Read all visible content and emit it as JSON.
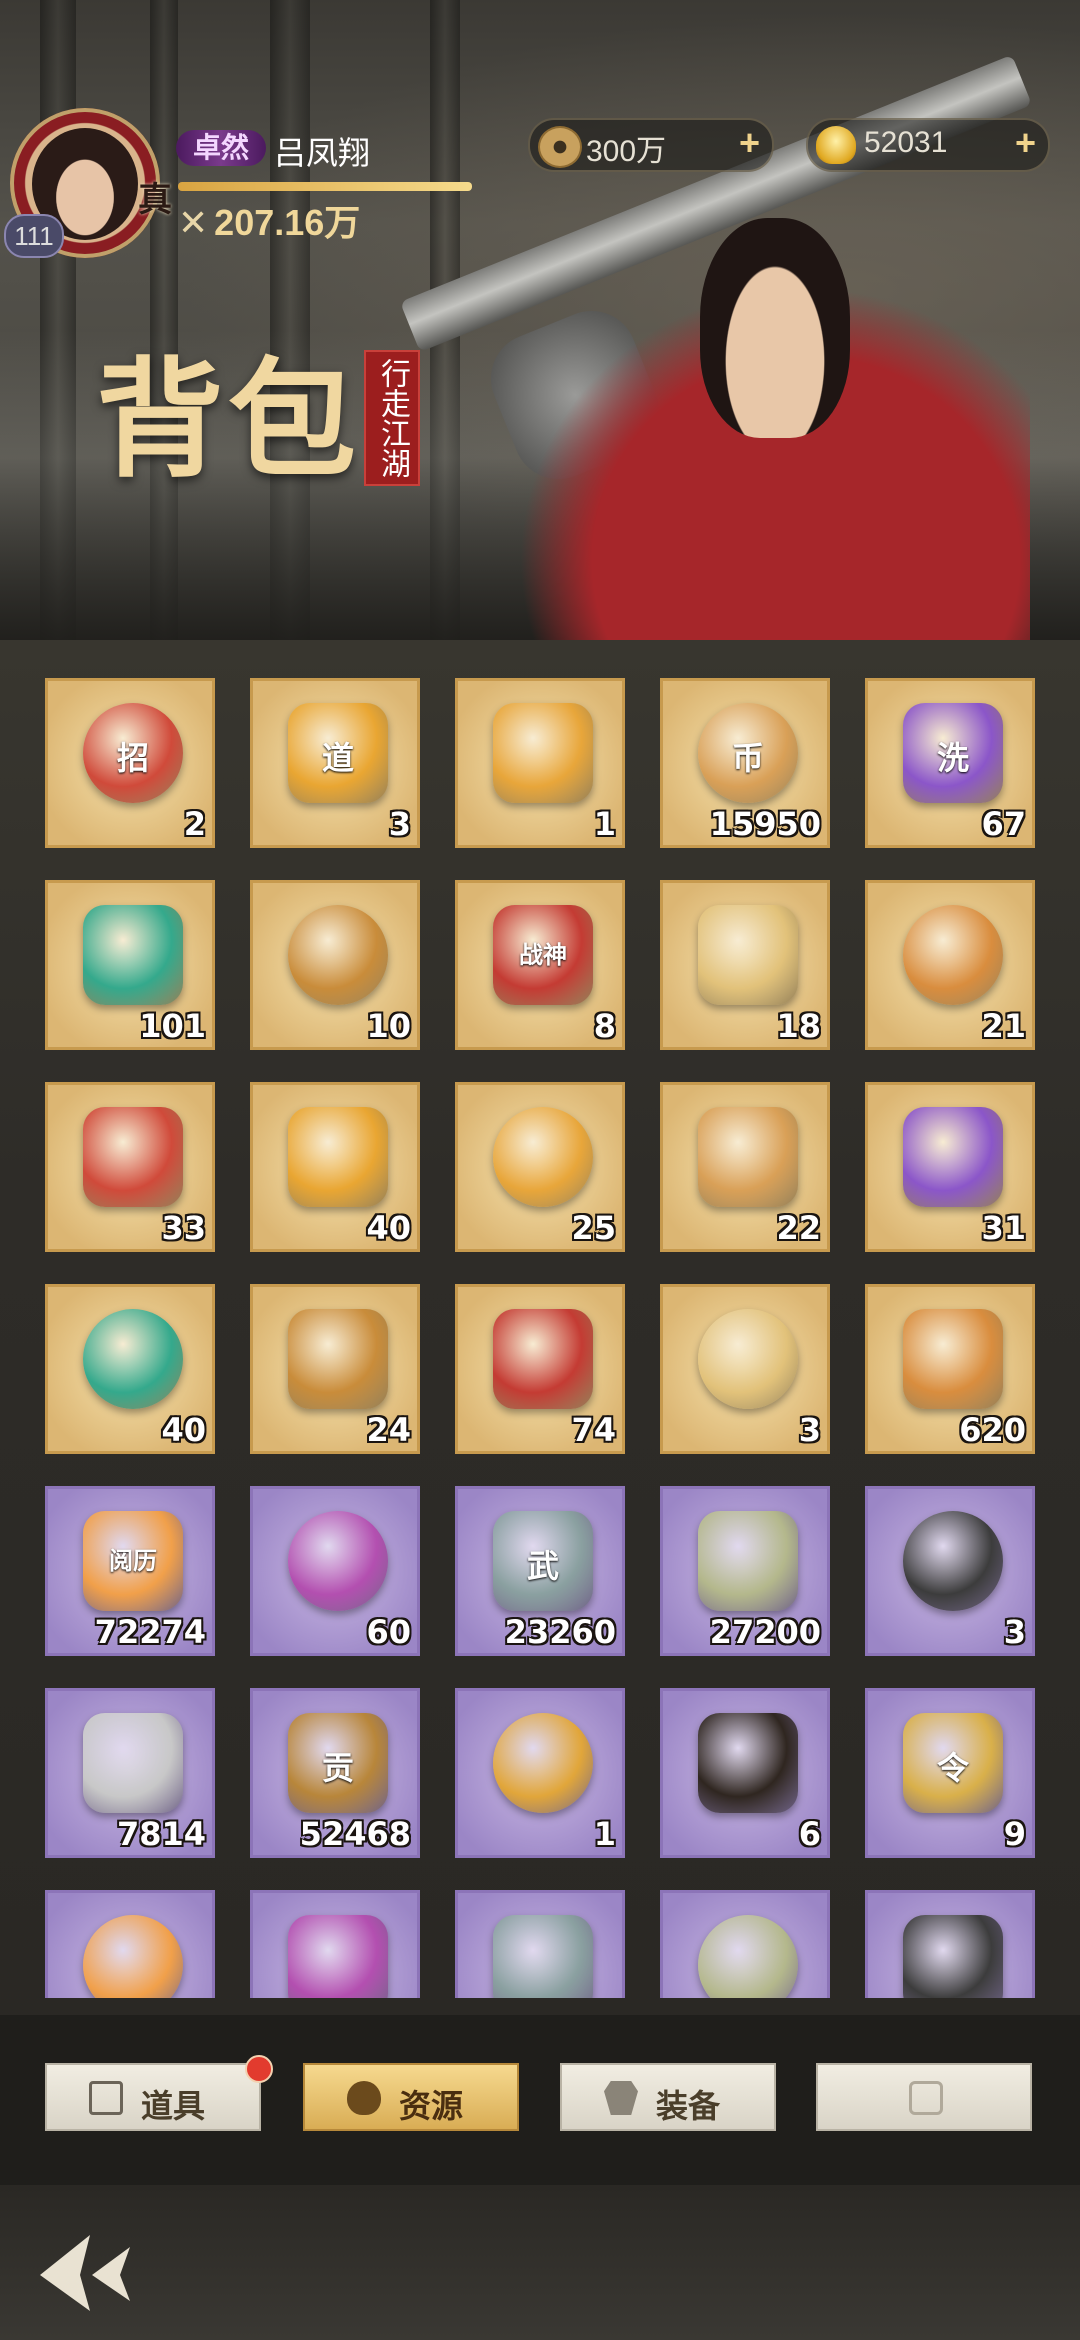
{
  "header": {
    "level": "111",
    "rank_mark": "真",
    "title_badge": "卓然",
    "player_name": "吕凤翔",
    "power": "207.16万",
    "page_title": "背包",
    "seal_text": "行走江湖"
  },
  "resources": {
    "coins": "300万",
    "ingots": "52031"
  },
  "items": [
    {
      "count": "2",
      "tier": "gold",
      "icon": "scroll-bundle-icon",
      "mark": "招"
    },
    {
      "count": "3",
      "tier": "gold",
      "icon": "gold-token-icon",
      "mark": "道"
    },
    {
      "count": "1",
      "tier": "gold",
      "icon": "golden-rose-icon",
      "mark": ""
    },
    {
      "count": "15950",
      "tier": "gold",
      "icon": "gold-ore-icon",
      "mark": "币"
    },
    {
      "count": "67",
      "tier": "gold",
      "icon": "purple-stone-icon",
      "mark": "洗"
    },
    {
      "count": "101",
      "tier": "gold",
      "icon": "jade-ring-icon",
      "mark": ""
    },
    {
      "count": "10",
      "tier": "gold",
      "icon": "gold-bar-icon",
      "mark": ""
    },
    {
      "count": "8",
      "tier": "gold",
      "icon": "war-token-icon",
      "mark": "战神"
    },
    {
      "count": "18",
      "tier": "gold",
      "icon": "sword-charm-icon",
      "mark": ""
    },
    {
      "count": "21",
      "tier": "gold",
      "icon": "orange-pill-tray-icon",
      "mark": ""
    },
    {
      "count": "33",
      "tier": "gold",
      "icon": "orange-pill-tray-icon",
      "mark": ""
    },
    {
      "count": "40",
      "tier": "gold",
      "icon": "orange-pill-tray-icon",
      "mark": ""
    },
    {
      "count": "25",
      "tier": "gold",
      "icon": "orange-pill-tray-icon",
      "mark": ""
    },
    {
      "count": "22",
      "tier": "gold",
      "icon": "green-pill-tray-icon",
      "mark": ""
    },
    {
      "count": "31",
      "tier": "gold",
      "icon": "green-pill-tray-icon",
      "mark": ""
    },
    {
      "count": "40",
      "tier": "gold",
      "icon": "green-pill-tray-icon",
      "mark": ""
    },
    {
      "count": "24",
      "tier": "gold",
      "icon": "green-pill-tray-icon",
      "mark": ""
    },
    {
      "count": "74",
      "tier": "gold",
      "icon": "jade-pendant-icon",
      "mark": ""
    },
    {
      "count": "3",
      "tier": "gold",
      "icon": "fire-swirl-icon",
      "mark": ""
    },
    {
      "count": "620",
      "tier": "gold",
      "icon": "blue-flame-icon",
      "mark": ""
    },
    {
      "count": "72274",
      "tier": "purple",
      "icon": "experience-orb-icon",
      "mark": "阅历"
    },
    {
      "count": "60",
      "tier": "purple",
      "icon": "purple-rose-icon",
      "mark": ""
    },
    {
      "count": "23260",
      "tier": "purple",
      "icon": "martial-coin-icon",
      "mark": "武"
    },
    {
      "count": "27200",
      "tier": "purple",
      "icon": "jade-tablet-icon",
      "mark": ""
    },
    {
      "count": "3",
      "tier": "purple",
      "icon": "iron-block-icon",
      "mark": ""
    },
    {
      "count": "7814",
      "tier": "purple",
      "icon": "silver-ore-icon",
      "mark": ""
    },
    {
      "count": "52468",
      "tier": "purple",
      "icon": "tribute-token-icon",
      "mark": "贡"
    },
    {
      "count": "1",
      "tier": "purple",
      "icon": "gold-nugget-icon",
      "mark": ""
    },
    {
      "count": "6",
      "tier": "purple",
      "icon": "dice-icon",
      "mark": ""
    },
    {
      "count": "9",
      "tier": "purple",
      "icon": "command-tablet-icon",
      "mark": "令"
    },
    {
      "count": "",
      "tier": "purple",
      "icon": "silver-coin-icon",
      "mark": ""
    },
    {
      "count": "",
      "tier": "purple",
      "icon": "teal-crystal-icon",
      "mark": ""
    },
    {
      "count": "",
      "tier": "purple",
      "icon": "dark-shard-icon",
      "mark": ""
    },
    {
      "count": "",
      "tier": "purple",
      "icon": "gold-ring-icon",
      "mark": ""
    },
    {
      "count": "",
      "tier": "purple",
      "icon": "bronze-charm-icon",
      "mark": ""
    }
  ],
  "tabs": [
    {
      "label": "道具",
      "icon": "chest-icon",
      "active": false,
      "badge": true
    },
    {
      "label": "资源",
      "icon": "money-bag-icon",
      "active": true,
      "badge": false
    },
    {
      "label": "装备",
      "icon": "armor-icon",
      "active": false,
      "badge": false
    },
    {
      "label": "",
      "icon": "lock-icon",
      "active": false,
      "badge": false
    }
  ],
  "colors": {
    "gold_cell": "#e8c98a",
    "purple_cell": "#b3a0d6",
    "accent": "#f0d79a",
    "alert": "#e23b2e"
  }
}
